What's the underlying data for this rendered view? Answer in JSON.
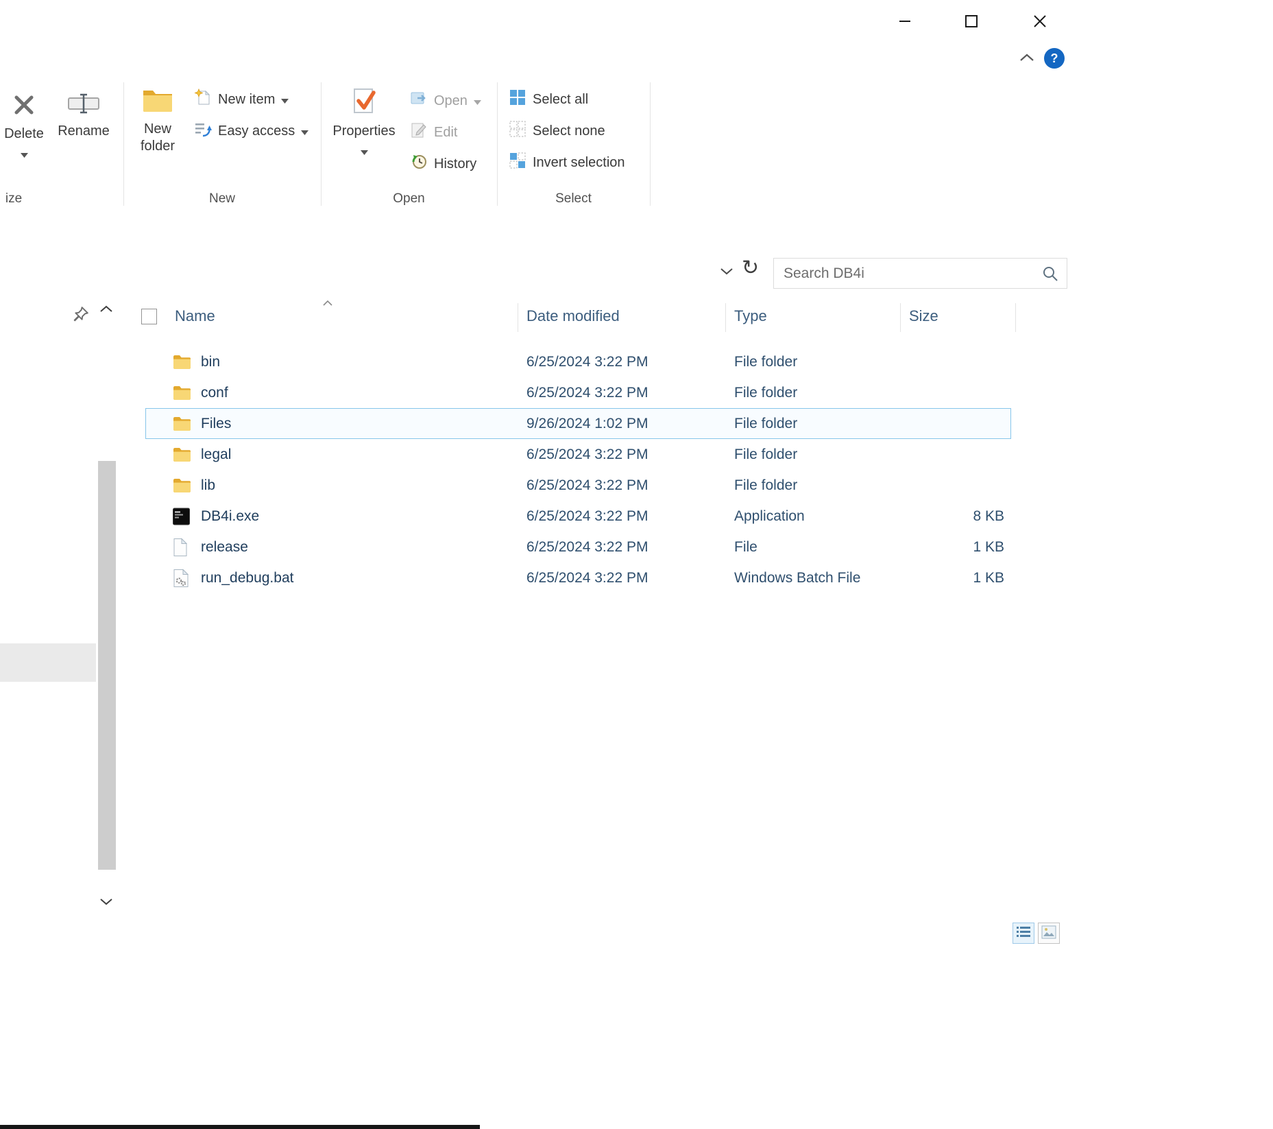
{
  "window": {
    "help_label": "?"
  },
  "icons": {
    "refresh": "↻"
  },
  "ribbon": {
    "delete": "Delete",
    "rename": "Rename",
    "new_folder_line1": "New",
    "new_folder_line2": "folder",
    "new_item": "New item",
    "easy_access": "Easy access",
    "properties": "Properties",
    "open": "Open",
    "edit": "Edit",
    "history": "History",
    "select_all": "Select all",
    "select_none": "Select none",
    "invert_selection": "Invert selection",
    "groups": {
      "organize": "ize",
      "new": "New",
      "open": "Open",
      "select": "Select"
    }
  },
  "search": {
    "placeholder": "Search DB4i"
  },
  "file_list": {
    "columns": {
      "name": "Name",
      "date": "Date modified",
      "type": "Type",
      "size": "Size"
    },
    "rows": [
      {
        "name": "bin",
        "date": "6/25/2024 3:22 PM",
        "type": "File folder",
        "size": "",
        "icon": "folder",
        "selected": false
      },
      {
        "name": "conf",
        "date": "6/25/2024 3:22 PM",
        "type": "File folder",
        "size": "",
        "icon": "folder",
        "selected": false
      },
      {
        "name": "Files",
        "date": "9/26/2024 1:02 PM",
        "type": "File folder",
        "size": "",
        "icon": "folder",
        "selected": true
      },
      {
        "name": "legal",
        "date": "6/25/2024 3:22 PM",
        "type": "File folder",
        "size": "",
        "icon": "folder",
        "selected": false
      },
      {
        "name": "lib",
        "date": "6/25/2024 3:22 PM",
        "type": "File folder",
        "size": "",
        "icon": "folder",
        "selected": false
      },
      {
        "name": "DB4i.exe",
        "date": "6/25/2024 3:22 PM",
        "type": "Application",
        "size": "8 KB",
        "icon": "exe",
        "selected": false
      },
      {
        "name": "release",
        "date": "6/25/2024 3:22 PM",
        "type": "File",
        "size": "1 KB",
        "icon": "file",
        "selected": false
      },
      {
        "name": "run_debug.bat",
        "date": "6/25/2024 3:22 PM",
        "type": "Windows Batch File",
        "size": "1 KB",
        "icon": "bat",
        "selected": false
      }
    ]
  },
  "colors": {
    "accent_blue": "#1467c2",
    "selection_border": "#86c5ea",
    "folder_yellow": "#f8d775",
    "check_orange": "#e8682e"
  }
}
